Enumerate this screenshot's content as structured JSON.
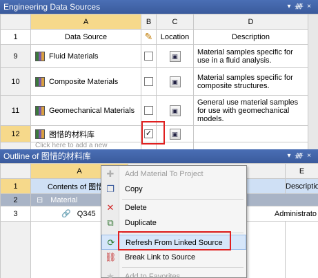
{
  "top_panel": {
    "title": "Engineering Data Sources",
    "columns": [
      "A",
      "B",
      "C",
      "D"
    ],
    "header_row": {
      "num": "1",
      "source": "Data Source",
      "location": "Location",
      "description": "Description"
    },
    "rows": [
      {
        "num": "9",
        "name": "Fluid Materials",
        "description": "Material samples specific for use in a fluid analysis.",
        "checked": false
      },
      {
        "num": "10",
        "name": "Composite Materials",
        "description": "Material samples specific for composite structures.",
        "checked": false
      },
      {
        "num": "11",
        "name": "Geomechanical Materials",
        "description": "General use material samples for use with geomechanical models.",
        "checked": false
      },
      {
        "num": "12",
        "name": "图惜的材料库",
        "description": "",
        "checked": true,
        "checkmark": "✓"
      }
    ],
    "add_row_hint": "Click here to add a new"
  },
  "outline_panel": {
    "title": "Outline of 图惜的材料库",
    "columns": [
      "A",
      "E"
    ],
    "header_row": {
      "num": "1",
      "contents": "Contents of 图惜的",
      "description": "Descriptio"
    },
    "rows": [
      {
        "num": "2",
        "label": "Material",
        "toggle": "⊟"
      },
      {
        "num": "3",
        "label": "Q345",
        "source_text": "Administrato"
      }
    ]
  },
  "context_menu": {
    "items": [
      {
        "label": "Add Material To Project",
        "icon": "add-icon",
        "glyph": "✚",
        "disabled": true
      },
      {
        "label": "Copy",
        "icon": "copy-icon",
        "glyph": "❐",
        "disabled": false
      },
      {
        "label": "Delete",
        "icon": "delete-icon",
        "glyph": "✕",
        "disabled": false
      },
      {
        "label": "Duplicate",
        "icon": "duplicate-icon",
        "glyph": "⧉",
        "disabled": false
      },
      {
        "label": "Refresh From Linked Source",
        "icon": "refresh-link-icon",
        "glyph": "⟳",
        "disabled": false,
        "highlighted": true
      },
      {
        "label": "Break Link to Source",
        "icon": "break-link-icon",
        "glyph": "⛓",
        "disabled": false
      },
      {
        "label": "Add to Favorites",
        "icon": "favorites-icon",
        "glyph": "★",
        "disabled": true
      }
    ]
  },
  "icons": {
    "pin": "ᚎ",
    "close": "×",
    "dropdown": "▾",
    "pencil": "✎",
    "location": "▣"
  },
  "colors": {
    "title_bar": "#3a5a9c",
    "selection_header": "#f6d98b",
    "highlight_box": "#e02020",
    "menu_highlight": "#d6e6fa"
  }
}
